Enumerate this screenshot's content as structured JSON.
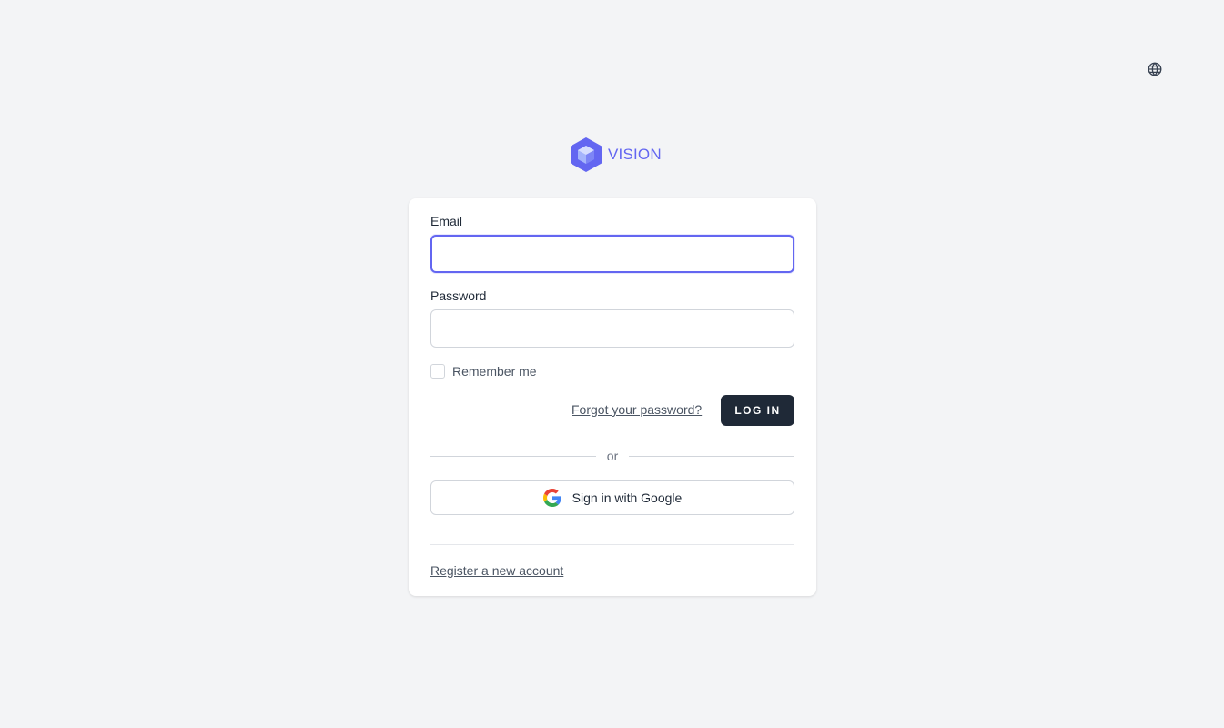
{
  "header": {
    "language_icon": "globe-icon"
  },
  "brand": {
    "name": "VISION",
    "logo_icon": "hexagon-cube-icon",
    "color": "#6366f1"
  },
  "form": {
    "email": {
      "label": "Email",
      "value": "",
      "placeholder": ""
    },
    "password": {
      "label": "Password",
      "value": "",
      "placeholder": ""
    },
    "remember_me": {
      "label": "Remember me",
      "checked": false
    },
    "forgot_password_link": "Forgot your password?",
    "login_button": "LOG IN",
    "divider_text": "or",
    "google_button": {
      "label": "Sign in with Google",
      "icon": "google-icon"
    },
    "register_link": "Register a new account"
  },
  "colors": {
    "accent": "#6366f1",
    "primary_button": "#1f2937",
    "background": "#f3f4f6"
  }
}
